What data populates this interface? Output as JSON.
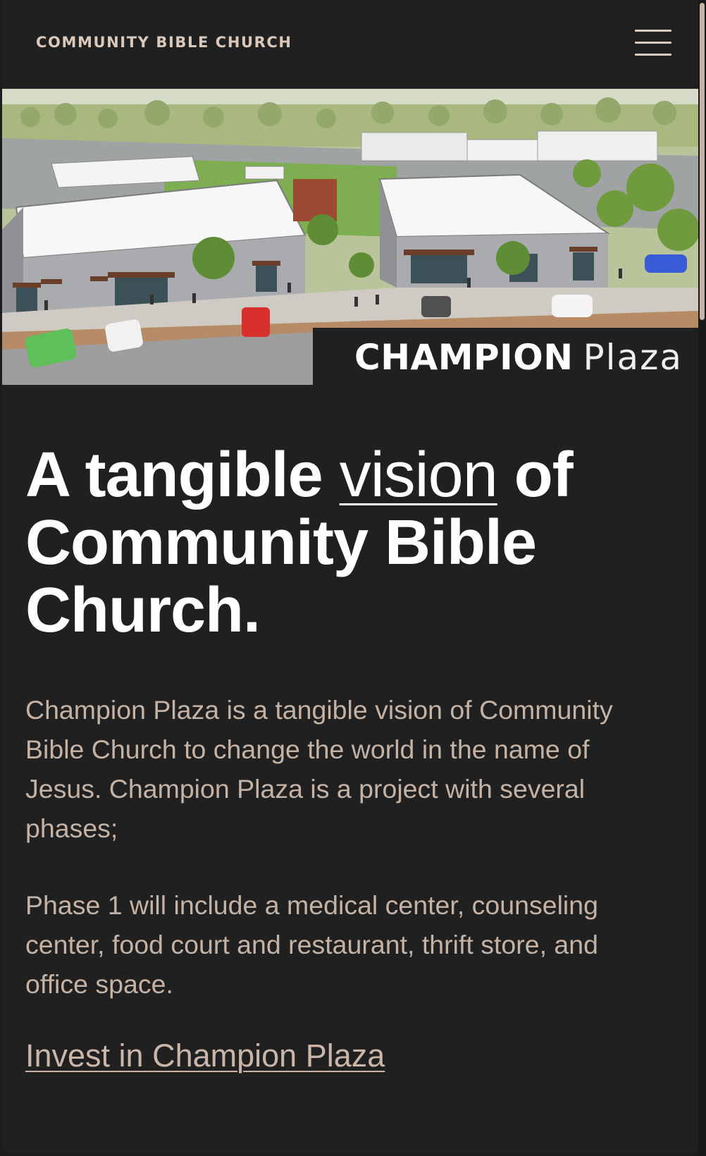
{
  "header": {
    "brand": "COMMUNITY BIBLE CHURCH",
    "menu_icon": "hamburger-menu-icon"
  },
  "hero": {
    "image_description_icon": "plaza-rendering-image",
    "caption_bold": "CHAMPION",
    "caption_light": "Plaza"
  },
  "headline": {
    "part1": "A tangible ",
    "emphasis": "vision",
    "part2": " of Community Bible Church."
  },
  "body": {
    "paragraph1": "Champion Plaza is a tangible vision of Community Bible Church to change the world in the name of Jesus. Champion Plaza is a project with several phases;",
    "paragraph2": "Phase 1 will include a medical center, counseling center, food court and restaurant, thrift store, and office space."
  },
  "cta": {
    "link_label": "Invest in Champion Plaza"
  },
  "colors": {
    "background": "#202020",
    "accent_text": "#c4b2a5",
    "headline": "#ffffff"
  }
}
